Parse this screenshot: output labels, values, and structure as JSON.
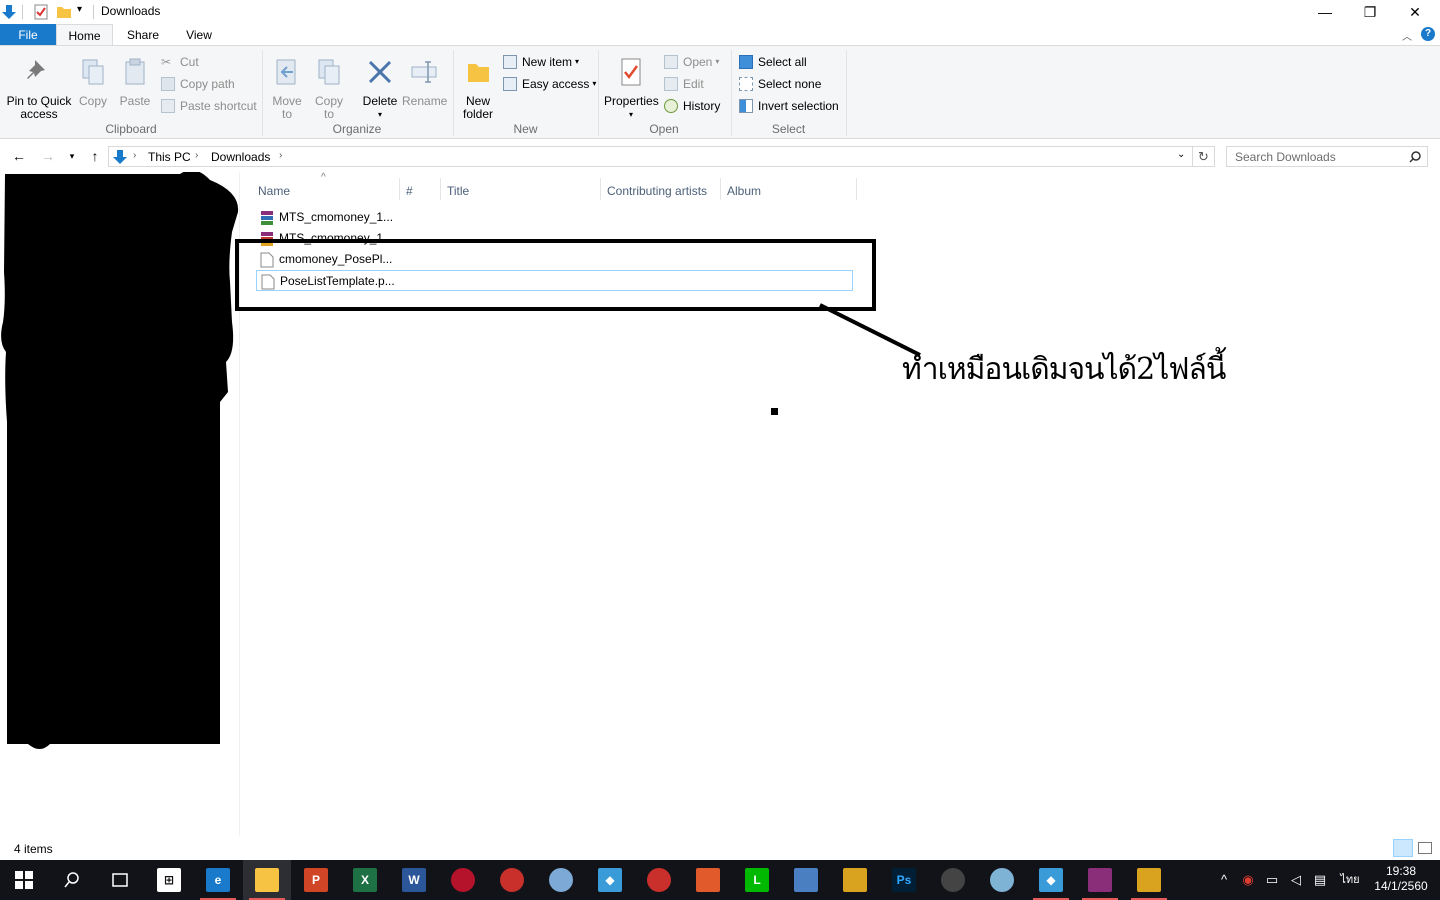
{
  "window": {
    "title": "Downloads",
    "controls": {
      "minimize": "—",
      "restore": "❐",
      "close": "✕"
    }
  },
  "ribbon": {
    "tabs": [
      "File",
      "Home",
      "Share",
      "View"
    ],
    "active_tab": "Home",
    "help": "?",
    "clipboard": {
      "pin_line1": "Pin to Quick",
      "pin_line2": "access",
      "copy": "Copy",
      "paste": "Paste",
      "cut": "Cut",
      "copy_path": "Copy path",
      "paste_shortcut": "Paste shortcut",
      "label": "Clipboard"
    },
    "organize": {
      "move_to_line1": "Move",
      "move_to_line2": "to",
      "copy_to_line1": "Copy",
      "copy_to_line2": "to",
      "delete": "Delete",
      "rename": "Rename",
      "label": "Organize"
    },
    "new": {
      "new_folder_line1": "New",
      "new_folder_line2": "folder",
      "new_item": "New item",
      "easy_access": "Easy access",
      "label": "New"
    },
    "open": {
      "properties": "Properties",
      "open": "Open",
      "edit": "Edit",
      "history": "History",
      "label": "Open"
    },
    "select": {
      "select_all": "Select all",
      "select_none": "Select none",
      "invert_selection": "Invert selection",
      "label": "Select"
    }
  },
  "address": {
    "segments": [
      "This PC",
      "Downloads"
    ],
    "search_placeholder": "Search Downloads"
  },
  "columns": [
    "Name",
    "#",
    "Title",
    "Contributing artists",
    "Album"
  ],
  "files": [
    {
      "name": "MTS_cmomoney_1...",
      "icon": "archive-icon"
    },
    {
      "name": "MTS_cmomoney_1...",
      "icon": "archive-icon"
    },
    {
      "name": "cmomoney_PosePl...",
      "icon": "file-icon"
    },
    {
      "name": "PoseListTemplate.p...",
      "icon": "file-icon"
    }
  ],
  "annotation": {
    "text": "ทำเหมือนเดิมจนได้2ไฟล์นี้"
  },
  "status": {
    "items_count": "4 items"
  },
  "taskbar": {
    "lang": "ไทย",
    "time": "19:38",
    "date": "14/1/2560",
    "apps": [
      "edge",
      "file-explorer",
      "powerpoint",
      "excel",
      "word",
      "app1",
      "app2",
      "paint",
      "sims",
      "app3",
      "app4",
      "line",
      "app5",
      "app6",
      "photoshop",
      "app7",
      "cloud",
      "sims2",
      "winrar",
      "app8"
    ]
  },
  "colors": {
    "accent": "#1979ca",
    "ribbon_bg": "#f5f6f7",
    "taskbar_bg": "#111318",
    "column_header_text": "#4c607a",
    "selection_border": "#99d1ff"
  }
}
